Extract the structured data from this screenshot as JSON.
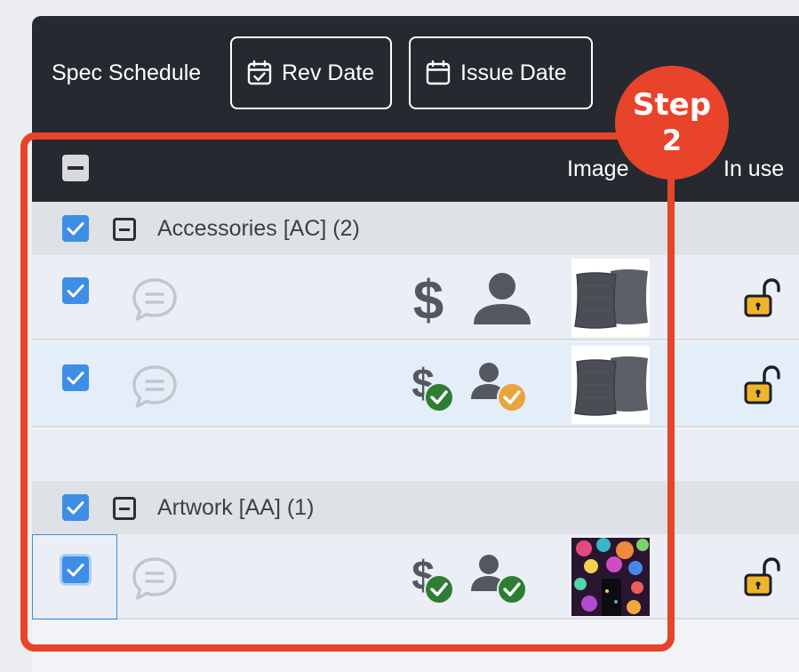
{
  "toolbar": {
    "title": "Spec Schedule",
    "rev_date_label": "Rev Date",
    "rev_date_icon": "calendar-check-icon",
    "issue_date_label": "Issue Date",
    "issue_date_icon": "calendar-icon"
  },
  "header": {
    "image_col": "Image",
    "in_use_col": "In use"
  },
  "groups": [
    {
      "label": "Accessories [AC] (2)",
      "checked": true,
      "rows": [
        {
          "checked": true,
          "price_status": "plain",
          "person_status": "plain",
          "thumbnail": "gray-pillows",
          "lock": "unlocked"
        },
        {
          "checked": true,
          "price_status": "approved",
          "person_status": "pending",
          "thumbnail": "gray-pillows",
          "lock": "unlocked"
        }
      ]
    },
    {
      "label": "Artwork [AA] (1)",
      "checked": true,
      "rows": [
        {
          "checked": true,
          "price_status": "approved",
          "person_status": "approved",
          "thumbnail": "floral-artwork",
          "lock": "unlocked"
        }
      ]
    }
  ],
  "callout": {
    "line1": "Step",
    "line2": "2"
  },
  "colors": {
    "toolbar_bg": "#262a30",
    "checkbox_blue": "#3e8ee6",
    "callout_red": "#e8432b",
    "approved_green": "#2e7d32",
    "pending_orange": "#e9a53a",
    "lock_yellow": "#f0b429"
  }
}
